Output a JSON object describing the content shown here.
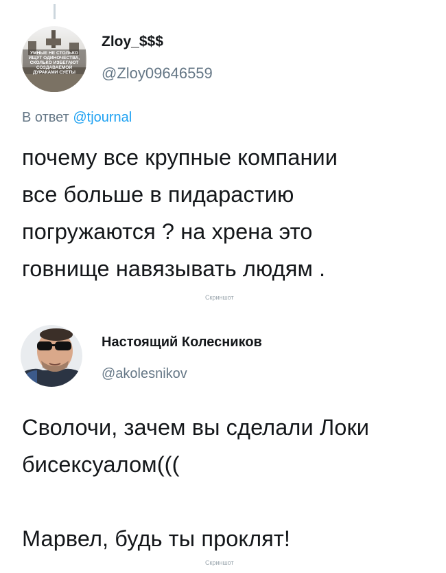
{
  "tweet1": {
    "display_name": "Zloy_$$$",
    "handle": "@Zloy09646559",
    "avatar_lines": [
      "УМНЫЕ НЕ СТОЛЬКО",
      "ИЩУТ ОДИНОЧЕСТВА,",
      "СКОЛЬКО ИЗБЕГАЮТ",
      "СОЗДАВАЕМОЙ",
      "ДУРАКАМИ СУЕТЫ"
    ],
    "reply_prefix": "В ответ ",
    "reply_mention": "@tjournal",
    "text": "почему все крупные компании\nвсе больше в пидарастию\nпогружаются ? на хрена это\nговнище навязывать людям ."
  },
  "watermark1": "Скриншот",
  "tweet2": {
    "display_name": "Настоящий Колесников",
    "handle": "@akolesnikov",
    "text": "Сволочи, зачем вы сделали Локи\nбисексуалом(((\n\nМарвел, будь ты проклят!"
  },
  "watermark2": "Скриншот",
  "colors": {
    "text": "#14171a",
    "secondary": "#657786",
    "link": "#1da1f2",
    "thread_line": "#ccd6dd"
  }
}
